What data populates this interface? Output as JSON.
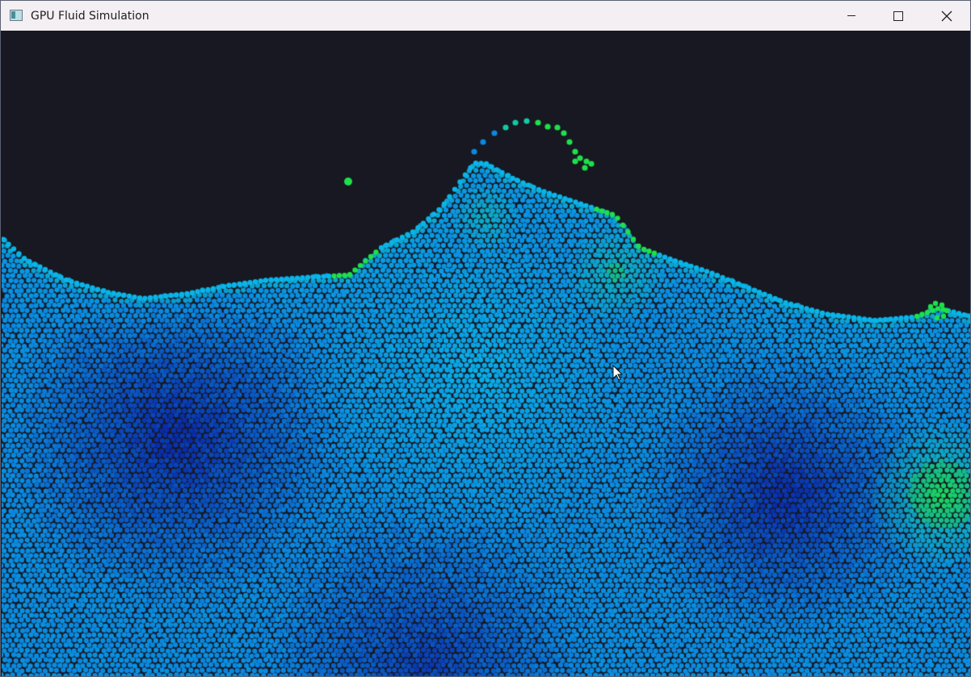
{
  "window": {
    "title": "GPU Fluid Simulation",
    "icon": "app-window-icon",
    "controls": {
      "minimize": "minimize-icon",
      "maximize": "maximize-icon",
      "close": "close-icon"
    }
  },
  "simulation": {
    "colors": {
      "background": "#171821",
      "deep": "#0a2ba8",
      "mid": "#0b88df",
      "light": "#0ab4e8",
      "teal": "#12c9a4",
      "green": "#1ee04a"
    },
    "particle_style": "circular dots",
    "cursor": "arrow-cursor-icon"
  }
}
